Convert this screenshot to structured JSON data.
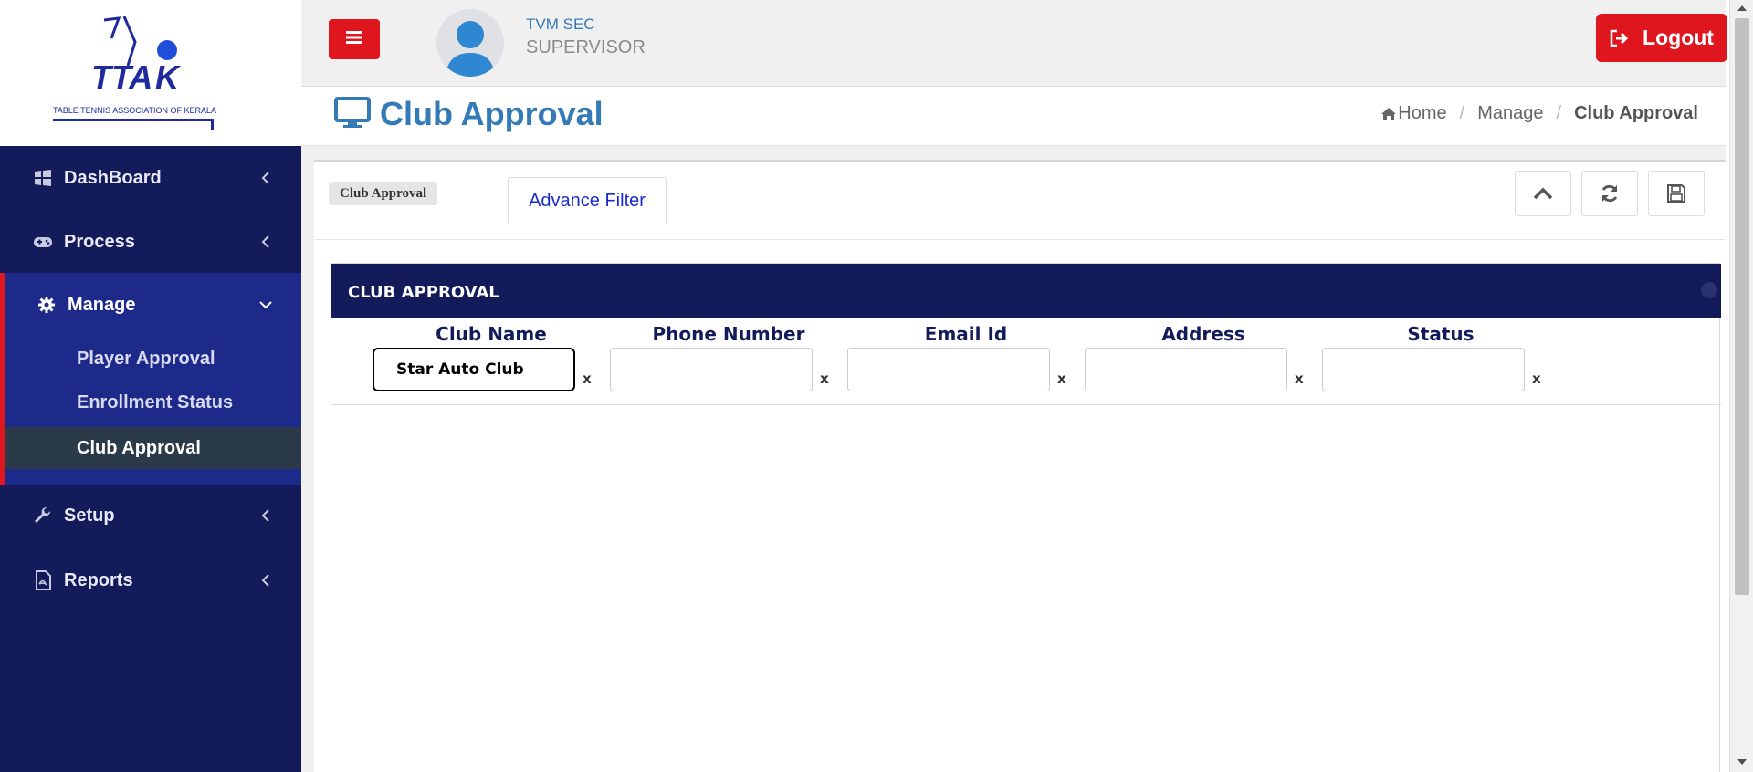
{
  "logo": {
    "letters": "TTA K",
    "subtitle": "TABLE TENNIS ASSOCIATION OF KERALA"
  },
  "sidebar": {
    "items": [
      {
        "label": "DashBoard",
        "icon": "windows-icon"
      },
      {
        "label": "Process",
        "icon": "gamepad-icon"
      },
      {
        "label": "Manage",
        "icon": "gear-icon"
      },
      {
        "label": "Setup",
        "icon": "wrench-icon"
      },
      {
        "label": "Reports",
        "icon": "pdf-file-icon"
      }
    ],
    "manage_children": [
      {
        "label": "Player Approval"
      },
      {
        "label": "Enrollment Status"
      },
      {
        "label": "Club Approval"
      }
    ]
  },
  "header": {
    "user_name": "TVM SEC",
    "user_role": "SUPERVISOR",
    "logout_label": "Logout"
  },
  "page": {
    "title": "Club Approval",
    "breadcrumb": {
      "home": "Home",
      "section": "Manage",
      "current": "Club Approval"
    }
  },
  "panel": {
    "tag": "Club Approval",
    "advance_filter": "Advance Filter"
  },
  "grid": {
    "title": "CLUB APPROVAL",
    "columns": [
      {
        "label": "Club Name",
        "value": "Star Auto Club",
        "clear": "x"
      },
      {
        "label": "Phone Number",
        "value": "",
        "clear": "x"
      },
      {
        "label": "Email Id",
        "value": "",
        "clear": "x"
      },
      {
        "label": "Address",
        "value": "",
        "clear": "x"
      },
      {
        "label": "Status",
        "value": "",
        "clear": "x"
      }
    ]
  },
  "colors": {
    "sidebar_bg": "#131b5a",
    "sidebar_active_group": "#1e2a8a",
    "accent_red": "#e0161f",
    "title_blue": "#337ab7"
  }
}
